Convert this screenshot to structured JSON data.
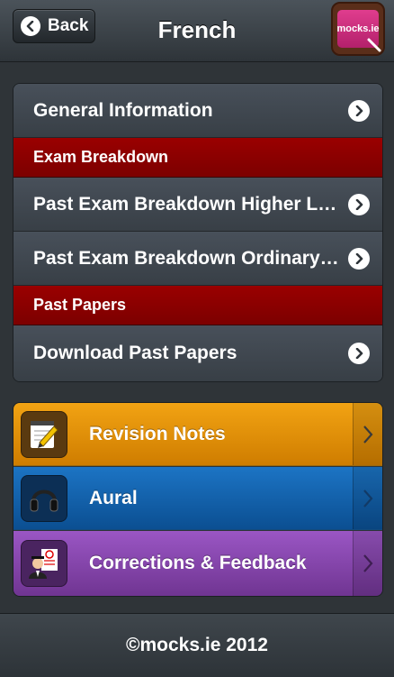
{
  "navbar": {
    "back_label": "Back",
    "title": "French",
    "logo_text": "mocks.ie"
  },
  "menu": {
    "general_info": "General Information",
    "section_exam": "Exam Breakdown",
    "past_higher": "Past Exam Breakdown Higher Level",
    "past_ordinary": "Past Exam Breakdown Ordinary Level",
    "section_papers": "Past Papers",
    "download_papers": "Download Past Papers"
  },
  "features": {
    "revision_notes": "Revision Notes",
    "aural": "Aural",
    "corrections": "Corrections & Feedback"
  },
  "colors": {
    "section_red": "#8c0000",
    "orange": "#e39200",
    "blue": "#1664ad",
    "purple": "#8746ad"
  },
  "footer": {
    "copyright": "©mocks.ie 2012"
  }
}
